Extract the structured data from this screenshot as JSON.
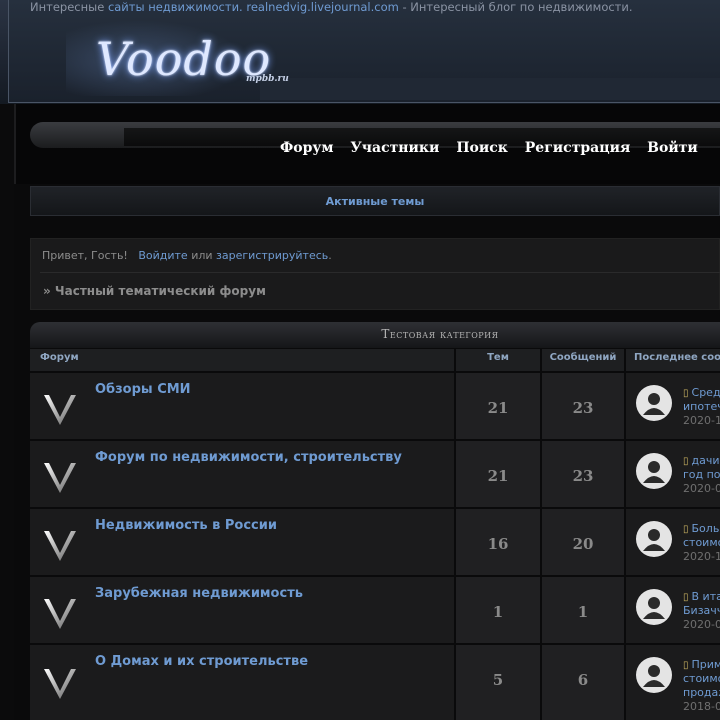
{
  "header": {
    "promo_prefix": "Интересные ",
    "promo_link": "сайты недвижимости. realnedvig.livejournal.com",
    "promo_suffix": " - Интересный блог по недвижимости.",
    "logo_text": "Voodoo",
    "logo_sub": "mpbb.ru"
  },
  "nav": {
    "items": [
      "Форум",
      "Участники",
      "Поиск",
      "Регистрация",
      "Войти"
    ]
  },
  "active_topics": "Активные темы",
  "greeting": {
    "prefix": "Привет, Гость!",
    "login": "Войдите",
    "or": "или",
    "register": "зарегистрируйтесь",
    "dot": "."
  },
  "breadcrumb": "» Частный тематический форум",
  "category": {
    "title": "Тестовая категория",
    "columns": {
      "forum": "Форум",
      "topics": "Тем",
      "posts": "Сообщений",
      "last": "Последнее сообщение"
    }
  },
  "forums": [
    {
      "title": "Обзоры СМИ",
      "topics": "21",
      "posts": "23",
      "last_lines": [
        "Средняя ставка по",
        "ипотечным кредитам",
        "2020-1"
      ]
    },
    {
      "title": "Форум по недвижимости, строительству",
      "topics": "21",
      "posts": "23",
      "last_lines": [
        "дачи продажа",
        "год под застройку",
        "2020-0"
      ]
    },
    {
      "title": "Недвижимость в России",
      "topics": "16",
      "posts": "20",
      "last_lines": [
        "Большинство",
        "стоимость",
        "2020-1"
      ]
    },
    {
      "title": "Зарубежная недвижимость",
      "topics": "1",
      "posts": "1",
      "last_lines": [
        "В италии",
        "Бизачча",
        "2020-0"
      ]
    },
    {
      "title": "О Домах и их строительстве",
      "topics": "5",
      "posts": "6",
      "last_lines": [
        "Применение",
        "стоимость",
        "продажа",
        "2018-0"
      ]
    }
  ]
}
